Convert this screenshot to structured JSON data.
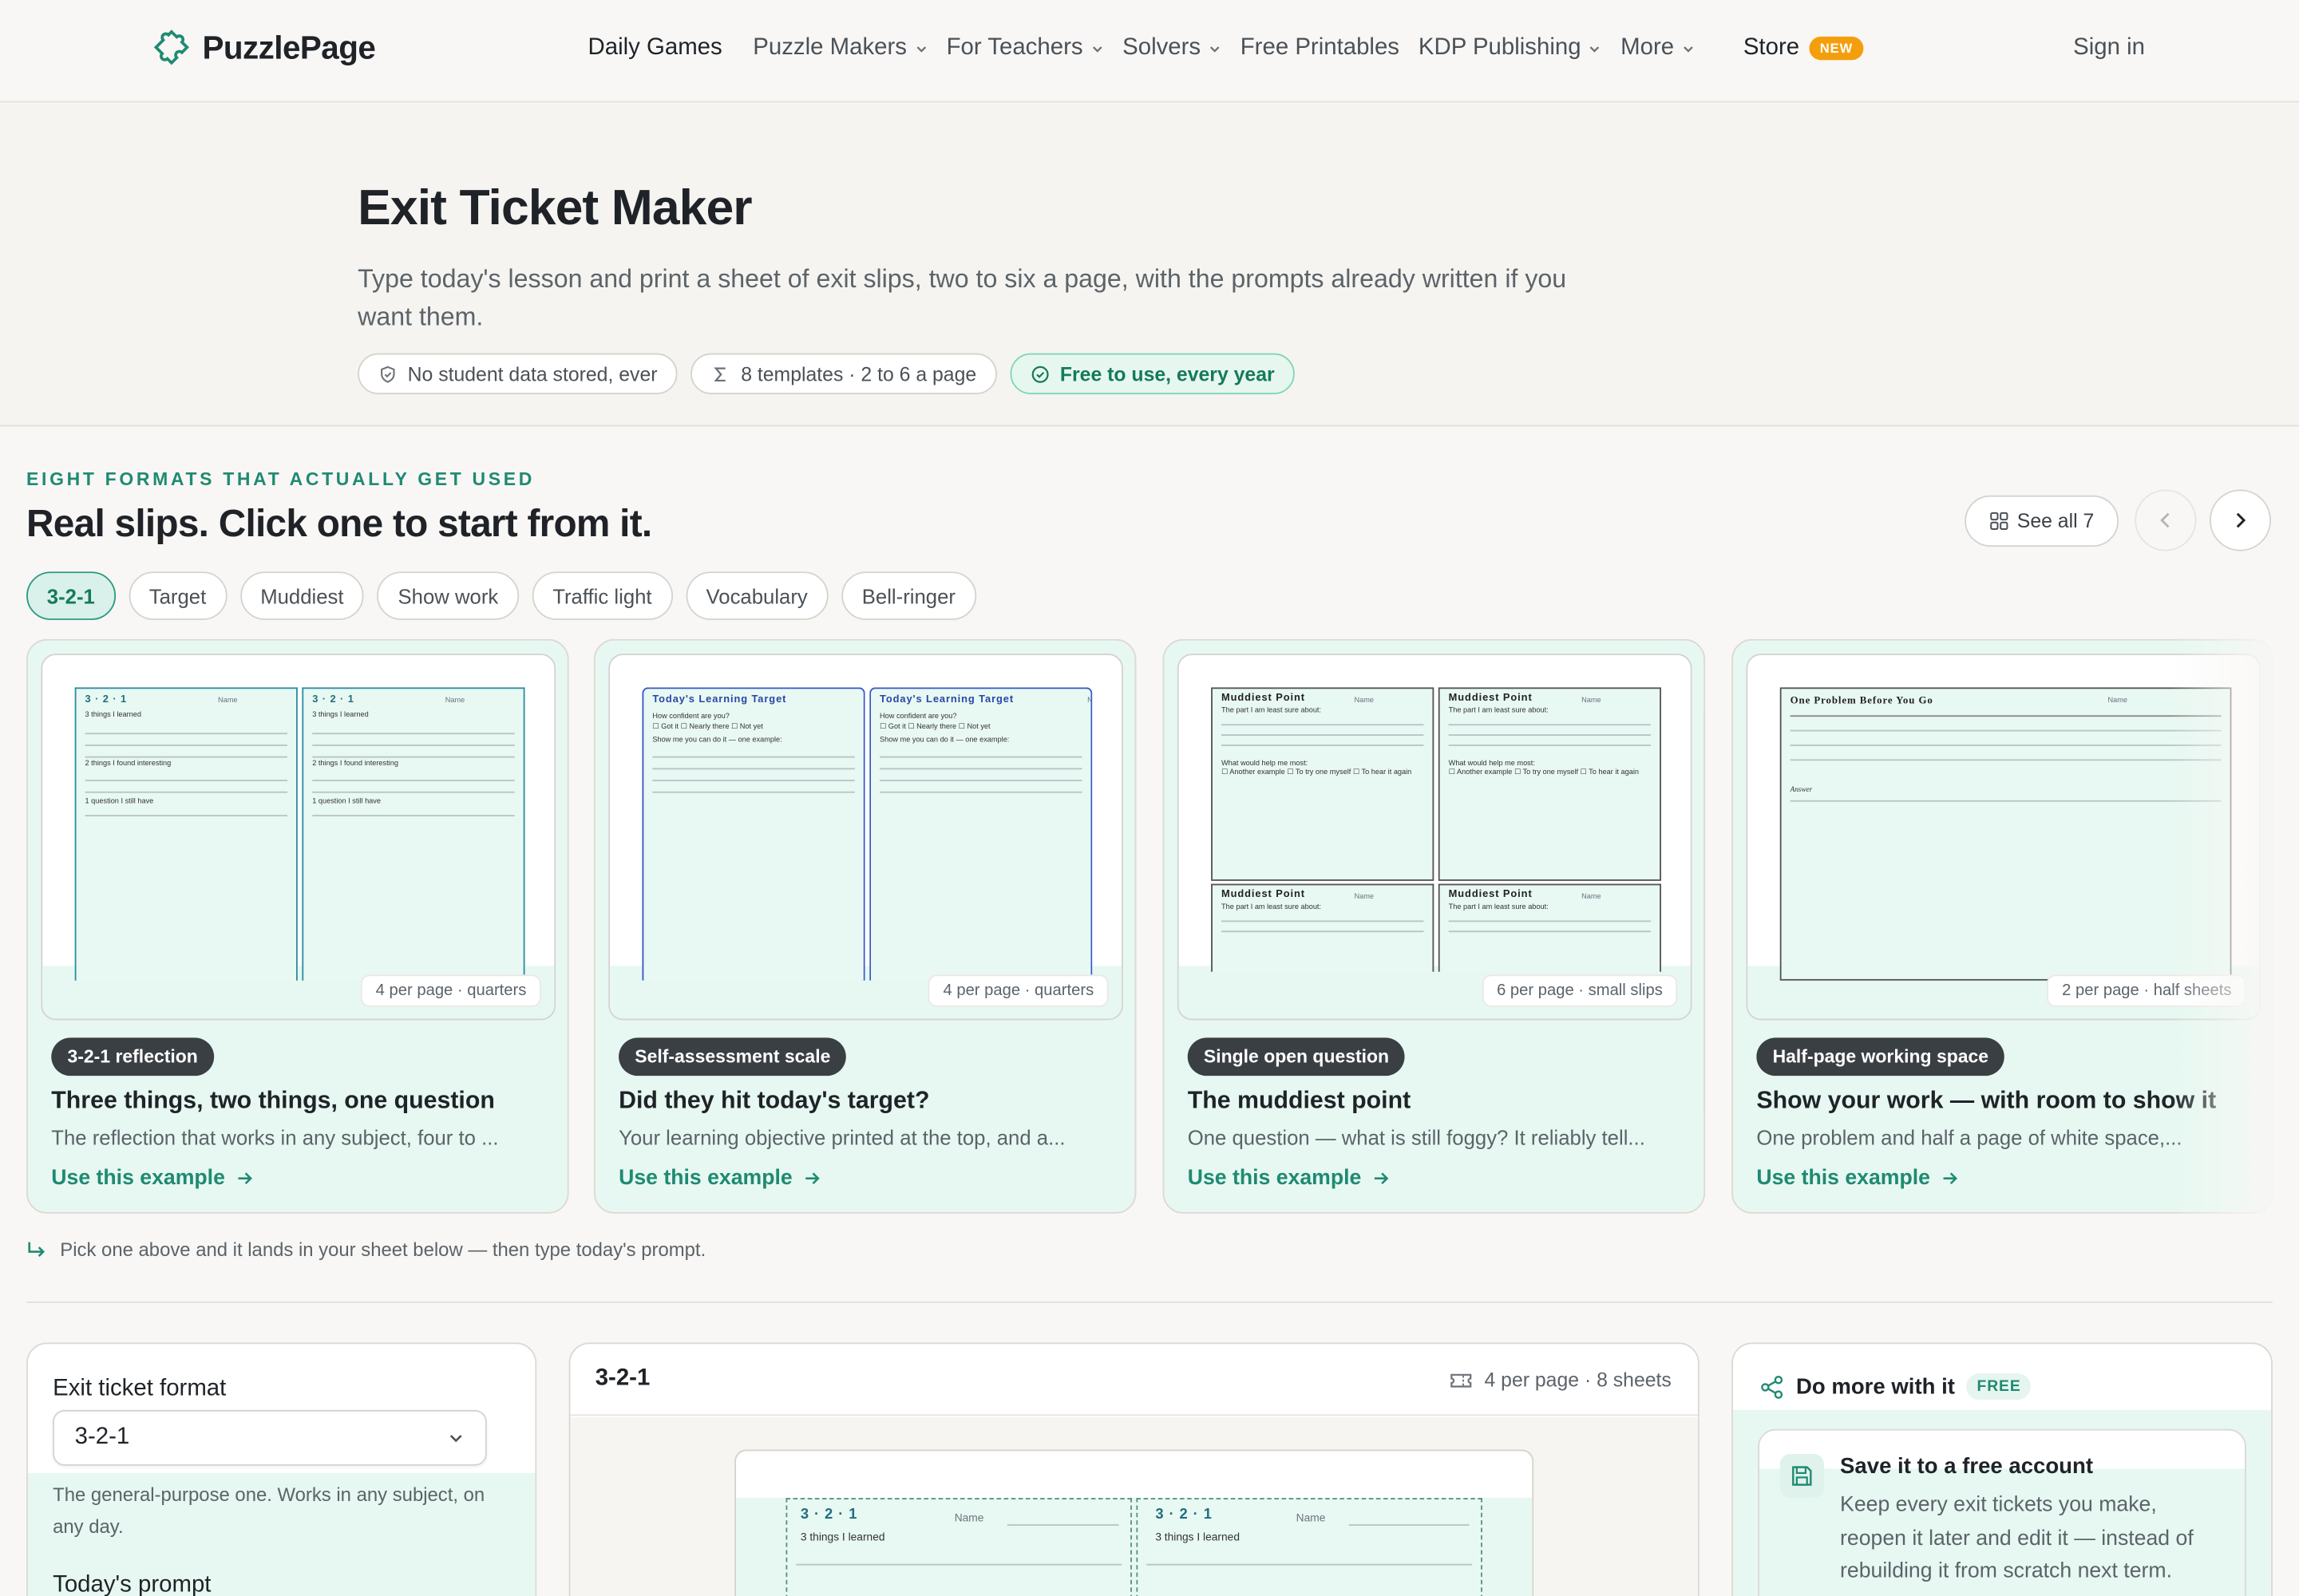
{
  "brand": {
    "name": "PuzzlePage"
  },
  "nav": {
    "links": [
      {
        "label": "Daily Games",
        "dropdown": false
      },
      {
        "label": "Puzzle Makers",
        "dropdown": true
      },
      {
        "label": "For Teachers",
        "dropdown": true
      },
      {
        "label": "Solvers",
        "dropdown": true
      },
      {
        "label": "Free Printables",
        "dropdown": false
      },
      {
        "label": "KDP Publishing",
        "dropdown": true
      },
      {
        "label": "More",
        "dropdown": true
      }
    ],
    "store_label": "Store",
    "store_badge": "NEW",
    "signin_label": "Sign in"
  },
  "hero": {
    "title": "Exit Ticket Maker",
    "subtitle": "Type today's lesson and print a sheet of exit slips, two to six a page, with the prompts already written if you want them.",
    "chips": [
      {
        "icon": "shield-icon",
        "label": "No student data stored, ever"
      },
      {
        "icon": "sigma-icon",
        "label": "8 templates · 2 to 6 a page"
      },
      {
        "icon": "check-circle-icon",
        "label": "Free to use, every year"
      }
    ]
  },
  "gallery": {
    "eyebrow": "EIGHT FORMATS THAT ACTUALLY GET USED",
    "title": "Real slips. Click one to start from it.",
    "see_all_label": "See all 7",
    "tabs": [
      "3-2-1",
      "Target",
      "Muddiest",
      "Show work",
      "Traffic light",
      "Vocabulary",
      "Bell-ringer"
    ],
    "active_tab": "3-2-1",
    "cards": [
      {
        "type": "3-2-1 reflection",
        "title": "Three things, two things, one question",
        "desc": "The reflection that works in any subject, four to ...",
        "per_page": "4 per page · quarters",
        "use_label": "Use this example",
        "thumb_title": "3 · 2 · 1",
        "thumb_name": "Name",
        "thumb_prompts": [
          "3 things I learned",
          "2 things I found interesting",
          "1 question I still have"
        ]
      },
      {
        "type": "Self-assessment scale",
        "title": "Did they hit today's target?",
        "desc": "Your learning objective printed at the top, and a...",
        "per_page": "4 per page · quarters",
        "use_label": "Use this example",
        "thumb_title": "Today's Learning Target",
        "thumb_name": "Na",
        "thumb_prompts": [
          "How confident are you?",
          "Got it",
          "Nearly there",
          "Not yet",
          "Show me you can do it — one example:"
        ]
      },
      {
        "type": "Single open question",
        "title": "The muddiest point",
        "desc": "One question — what is still foggy? It reliably tell...",
        "per_page": "6 per page · small slips",
        "use_label": "Use this example",
        "thumb_title": "Muddiest Point",
        "thumb_name": "Name",
        "thumb_prompts": [
          "The part I am least sure about:",
          "What would help me most:",
          "Another example",
          "To try one myself",
          "To hear it again"
        ]
      },
      {
        "type": "Half-page working space",
        "title": "Show your work — with room to show it",
        "desc": "One problem and half a page of white space,...",
        "per_page": "2 per page · half sheets",
        "use_label": "Use this example",
        "thumb_title": "One Problem Before You Go",
        "thumb_name": "Name",
        "thumb_prompts": [
          "Answer"
        ]
      }
    ],
    "hint": "Pick one above and it lands in your sheet below — then type today's prompt."
  },
  "editor": {
    "format_label": "Exit ticket format",
    "format_value": "3-2-1",
    "format_help": "The general-purpose one. Works in any subject, on any day.",
    "prompt_label": "Today's prompt"
  },
  "preview": {
    "title": "3-2-1",
    "meta": "4 per page · 8 sheets",
    "slip_title": "3 · 2 · 1",
    "slip_name": "Name",
    "slip_first_prompt": "3 things I learned"
  },
  "more": {
    "title": "Do more with it",
    "tag": "FREE",
    "save_title": "Save it to a free account",
    "save_desc": "Keep every exit tickets you make, reopen it later and edit it — instead of rebuilding it from scratch next term."
  },
  "colors": {
    "accent": "#1f8a72",
    "mint": "#e6f8f1",
    "badge": "#f59e0b",
    "dark_pill": "#3a3f44"
  }
}
